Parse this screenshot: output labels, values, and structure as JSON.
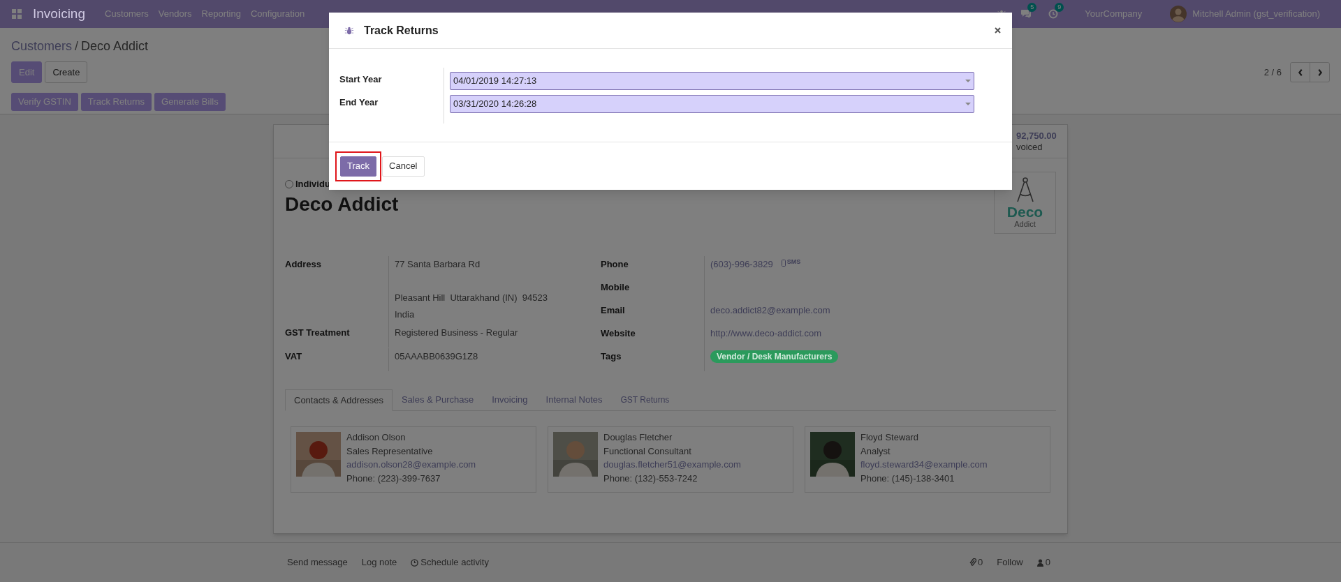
{
  "navbar": {
    "app_name": "Invoicing",
    "menu": [
      "Customers",
      "Vendors",
      "Reporting",
      "Configuration"
    ],
    "chat_count": "5",
    "activity_count": "9",
    "company": "YourCompany",
    "user": "Mitchell Admin (gst_verification)"
  },
  "breadcrumb": {
    "separator": "/",
    "items": [
      {
        "label": "Customers",
        "kind": "link"
      },
      {
        "label": "Deco Addict",
        "kind": "current"
      }
    ]
  },
  "control_buttons": [
    {
      "label": "Edit",
      "kind": "primary"
    },
    {
      "label": "Create",
      "kind": "secondary"
    }
  ],
  "pager": "2 / 6",
  "action_buttons": [
    "Verify GSTIN",
    "Track Returns",
    "Generate Bills"
  ],
  "record": {
    "stat": {
      "value": "92,750.00",
      "label": "voiced"
    },
    "company_type": {
      "label": "Individu",
      "selected": false
    },
    "name": "Deco Addict",
    "logo": {
      "line1": "Deco",
      "line2": "Addict"
    },
    "left_fields": [
      {
        "kind": "address",
        "label": "Address",
        "street": "77 Santa Barbara Rd",
        "city_line": "Pleasant Hill  Uttarakhand (IN)  94523",
        "country": "India"
      },
      {
        "kind": "text",
        "label": "GST Treatment",
        "value": "Registered Business - Regular"
      },
      {
        "kind": "text",
        "label": "VAT",
        "value": "05AAABB0639G1Z8"
      }
    ],
    "right_fields": [
      {
        "kind": "phone",
        "label": "Phone",
        "value": "(603)-996-3829",
        "action": "SMS"
      },
      {
        "kind": "empty",
        "label": "Mobile"
      },
      {
        "kind": "link",
        "label": "Email",
        "value": "deco.addict82@example.com"
      },
      {
        "kind": "link",
        "label": "Website",
        "value": "http://www.deco-addict.com"
      },
      {
        "kind": "tags",
        "label": "Tags",
        "tags": [
          {
            "label": "Vendor / Desk Manufacturers",
            "color": "#2b9a5c"
          }
        ]
      }
    ],
    "tabs": [
      {
        "label": "Contacts & Addresses",
        "selected": true
      },
      {
        "label": "Sales & Purchase",
        "selected": false
      },
      {
        "label": "Invoicing",
        "selected": false
      },
      {
        "label": "Internal Notes",
        "selected": false
      },
      {
        "label": "GST Returns",
        "selected": false
      }
    ],
    "contacts": [
      {
        "name": "Addison Olson",
        "function": "Sales Representative",
        "email": "addison.olson28@example.com",
        "phone": "Phone: (223)-399-7637"
      },
      {
        "name": "Douglas Fletcher",
        "function": "Functional Consultant",
        "email": "douglas.fletcher51@example.com",
        "phone": "Phone: (132)-553-7242"
      },
      {
        "name": "Floyd Steward",
        "function": "Analyst",
        "email": "floyd.steward34@example.com",
        "phone": "Phone: (145)-138-3401"
      }
    ]
  },
  "chatter": {
    "actions": [
      {
        "label": "Send message",
        "kind": "message"
      },
      {
        "label": "Log note",
        "kind": "note"
      },
      {
        "label": "Schedule activity",
        "kind": "activity"
      }
    ],
    "attachments": "0",
    "follow": "Follow",
    "followers": "0"
  },
  "dialog": {
    "title": "Track Returns",
    "fields": [
      {
        "label": "Start Year",
        "value": "04/01/2019 14:27:13"
      },
      {
        "label": "End Year",
        "value": "03/31/2020 14:26:28"
      }
    ],
    "buttons": [
      {
        "label": "Track",
        "kind": "primary",
        "highlighted": true
      },
      {
        "label": "Cancel",
        "kind": "secondary",
        "highlighted": false
      }
    ]
  }
}
